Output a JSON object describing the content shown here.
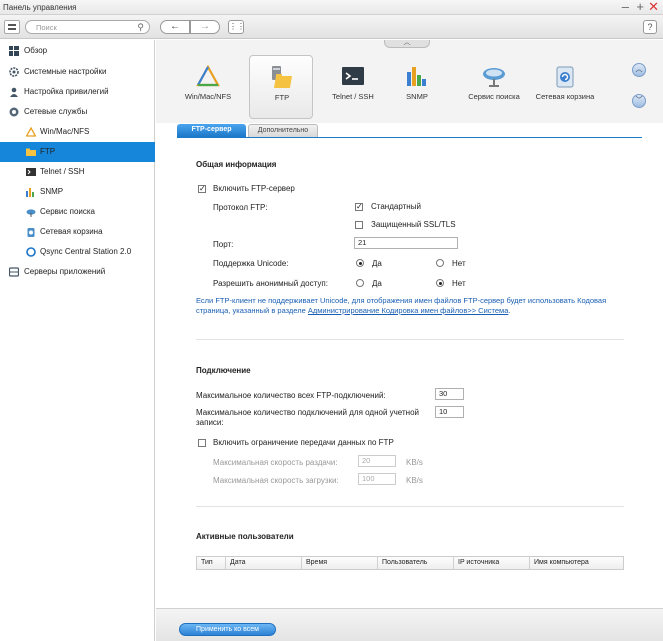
{
  "window": {
    "title": "Панель управления"
  },
  "toolbar": {
    "search_placeholder": "Поиск"
  },
  "sidebar": {
    "items": [
      {
        "label": "Обзор"
      },
      {
        "label": "Системные настройки"
      },
      {
        "label": "Настройка привилегий"
      },
      {
        "label": "Сетевые службы"
      },
      {
        "label": "Win/Mac/NFS"
      },
      {
        "label": "FTP"
      },
      {
        "label": "Telnet / SSH"
      },
      {
        "label": "SNMP"
      },
      {
        "label": "Сервис поиска"
      },
      {
        "label": "Сетевая корзина"
      },
      {
        "label": "Qsync Central Station 2.0"
      },
      {
        "label": "Серверы приложений"
      }
    ]
  },
  "services": [
    {
      "label": "Win/Mac/NFS",
      "icon": "triangle-share-icon"
    },
    {
      "label": "FTP",
      "icon": "ftp-folder-icon"
    },
    {
      "label": "Telnet / SSH",
      "icon": "terminal-icon"
    },
    {
      "label": "SNMP",
      "icon": "bar-chart-icon"
    },
    {
      "label": "Сервис поиска",
      "icon": "satellite-dish-icon"
    },
    {
      "label": "Сетевая корзина",
      "icon": "recycle-bin-icon"
    }
  ],
  "tabs": [
    {
      "label": "FTP-сервер"
    },
    {
      "label": "Дополнительно"
    }
  ],
  "general": {
    "title": "Общая информация",
    "enable_ftp": "Включить FTP-сервер",
    "protocol_label": "Протокол FTP:",
    "protocol_standard": "Стандартный",
    "protocol_ssl": "Защищенный SSL/TLS",
    "port_label": "Порт:",
    "port_value": "21",
    "unicode_label": "Поддержка Unicode:",
    "anon_label": "Разрешить анонимный доступ:",
    "yes": "Да",
    "no": "Нет",
    "note_text": "Если FTP-клиент не поддерживает Unicode, для отображения имен файлов FTP-сервер будет использовать Кодовая страница, указанный в разделе ",
    "note_link": "Администрирование Кодировка имен файлов>> Система",
    "note_end": "."
  },
  "connection": {
    "title": "Подключение",
    "max_all_label": "Максимальное количество всех FTP-подключений:",
    "max_all_value": "30",
    "max_per_label": "Максимальное количество подключений для одной учетной записи:",
    "max_per_value": "10",
    "limit_label": "Включить ограничение передачи данных по FTP",
    "upload_label": "Максимальная скорость раздачи:",
    "upload_value": "20",
    "download_label": "Максимальная скорость загрузки:",
    "download_value": "100",
    "unit": "KB/s"
  },
  "active_users": {
    "title": "Активные пользователи",
    "columns": [
      "Тип",
      "Дата",
      "Время",
      "Пользователь",
      "IP источника",
      "Имя компьютера"
    ]
  },
  "footer": {
    "apply_label": "Применить ко всем"
  }
}
